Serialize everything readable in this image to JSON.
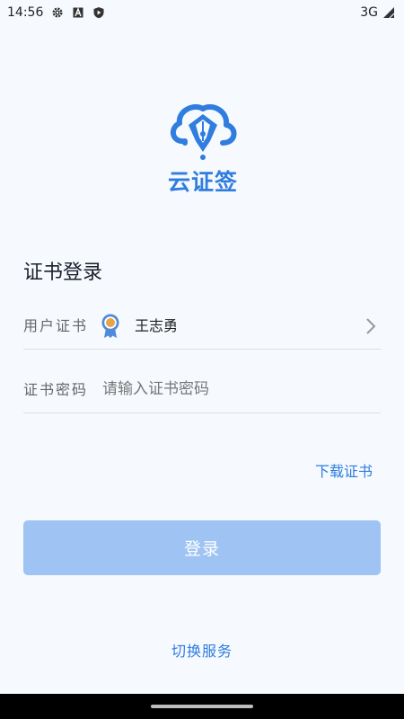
{
  "status_bar": {
    "time": "14:56",
    "left_icons": [
      "gear-icon",
      "font-a-icon",
      "shield-play-icon"
    ],
    "network": "3G",
    "right_icons": [
      "signal-icon"
    ]
  },
  "app": {
    "logo_text": "云证签",
    "brand_color": "#2f7ddf"
  },
  "login": {
    "section_title": "证书登录",
    "cert_label": "用户证书",
    "cert_value": "王志勇",
    "password_label": "证书密码",
    "password_placeholder": "请输入证书密码",
    "download_cert": "下载证书",
    "login_button": "登录",
    "switch_service": "切换服务"
  }
}
